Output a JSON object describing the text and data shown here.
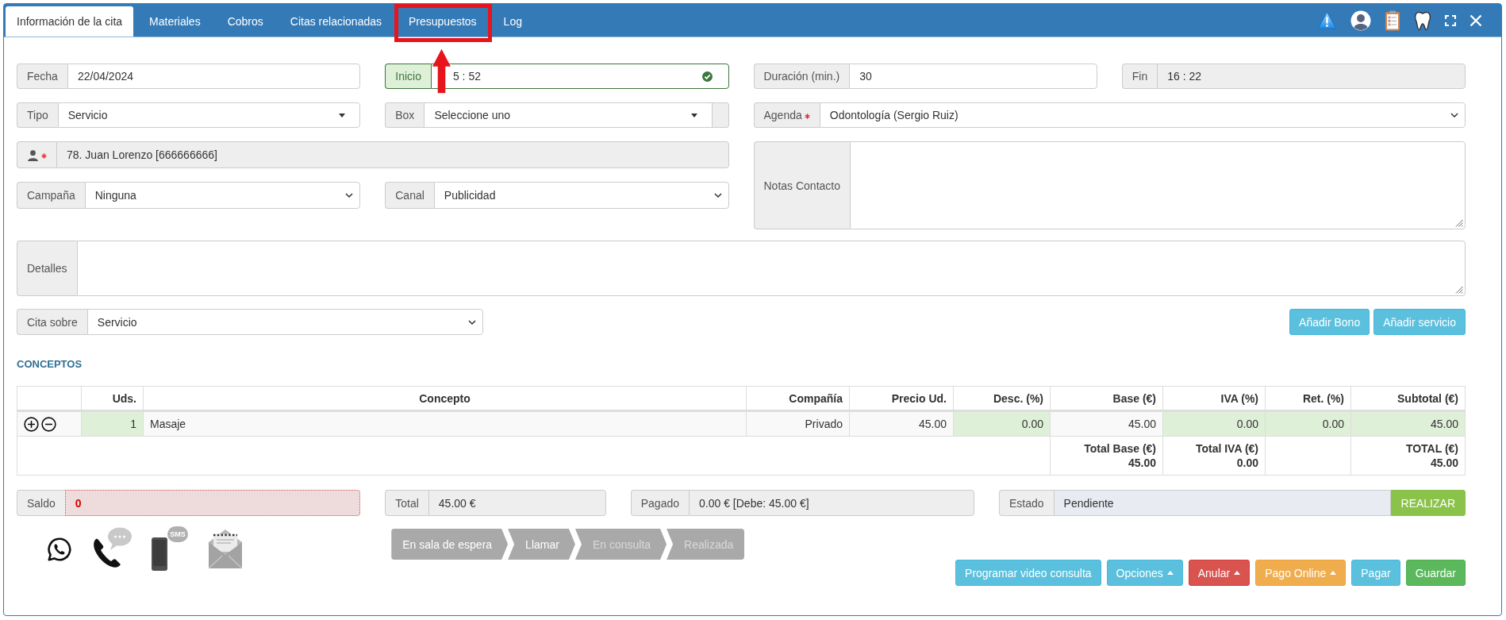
{
  "tabs": [
    {
      "label": "Información de la cita",
      "selected": true,
      "highlighted": false
    },
    {
      "label": "Materiales",
      "selected": false,
      "highlighted": false
    },
    {
      "label": "Cobros",
      "selected": false,
      "highlighted": false
    },
    {
      "label": "Citas relacionadas",
      "selected": false,
      "highlighted": false
    },
    {
      "label": "Presupuestos",
      "selected": false,
      "highlighted": true
    },
    {
      "label": "Log",
      "selected": false,
      "highlighted": false
    }
  ],
  "form": {
    "fecha": {
      "label": "Fecha",
      "value": "22/04/2024"
    },
    "inicio": {
      "label": "Inicio",
      "value": "5 : 52",
      "valid": true
    },
    "duracion": {
      "label": "Duración (min.)",
      "value": "30"
    },
    "fin": {
      "label": "Fin",
      "value": "16 : 22",
      "readonly": true
    },
    "tipo": {
      "kind": "picker",
      "label": "Tipo",
      "value": "Servicio"
    },
    "box": {
      "kind": "picker",
      "label": "Box",
      "value": "Seleccione uno",
      "addon": true
    },
    "agenda": {
      "kind": "select",
      "label": "Agenda",
      "value": "Odontología (Sergio Ruiz)",
      "required": true
    },
    "paciente": {
      "value": "78. Juan Lorenzo [666666666]",
      "readonly": true,
      "required": true
    },
    "notas_contacto": {
      "kind": "textarea",
      "label": "Notas Contacto"
    },
    "campana": {
      "kind": "select",
      "label": "Campaña",
      "value": "Ninguna"
    },
    "canal": {
      "kind": "select",
      "label": "Canal",
      "value": "Publicidad"
    },
    "detalles": {
      "kind": "textarea",
      "label": "Detalles"
    },
    "cita_sobre": {
      "kind": "select",
      "label": "Cita sobre",
      "value": "Servicio"
    }
  },
  "concept_buttons": [
    {
      "label": "Añadir Bono",
      "kind": "info"
    },
    {
      "label": "Añadir servicio",
      "kind": "info"
    }
  ],
  "conceptos": {
    "title": "CONCEPTOS",
    "columns": [
      "Uds.",
      "Concepto",
      "Compañía",
      "Precio Ud.",
      "Desc. (%)",
      "Base (€)",
      "IVA (%)",
      "Ret. (%)",
      "Subtotal (€)"
    ],
    "rows": [
      {
        "cells": [
          {
            "text": "1",
            "editable": true
          },
          {
            "text": "Masaje",
            "editable": false
          },
          {
            "text": "Privado",
            "editable": false
          },
          {
            "text": "45.00",
            "editable": false
          },
          {
            "text": "0.00",
            "editable": true
          },
          {
            "text": "45.00",
            "editable": false
          },
          {
            "text": "0.00",
            "editable": true
          },
          {
            "text": "0.00",
            "editable": true
          },
          {
            "text": "45.00",
            "editable": true
          }
        ]
      }
    ],
    "totals": {
      "base": {
        "label": "Total Base (€)",
        "value": "45.00"
      },
      "iva": {
        "label": "Total IVA (€)",
        "value": "0.00"
      },
      "total": {
        "label": "TOTAL (€)",
        "value": "45.00"
      }
    }
  },
  "summary": {
    "saldo": {
      "label": "Saldo",
      "value": "0",
      "error": true
    },
    "total": {
      "label": "Total",
      "value": "45.00 €",
      "readonly": true
    },
    "pagado": {
      "label": "Pagado",
      "value": "0.00 € [Debe: 45.00 €]",
      "readonly": true
    },
    "estado": {
      "label": "Estado",
      "value": "Pendiente",
      "action": "REALIZAR"
    }
  },
  "contact_actions": {
    "sms_label": "SMS"
  },
  "steps": [
    {
      "label": "En sala de espera",
      "reached": true
    },
    {
      "label": "Llamar",
      "reached": true
    },
    {
      "label": "En consulta",
      "reached": false
    },
    {
      "label": "Realizada",
      "reached": false
    }
  ],
  "buttons": [
    {
      "label": "Programar video consulta",
      "kind": "info",
      "menu": false
    },
    {
      "label": "Opciones",
      "kind": "info",
      "menu": true
    },
    {
      "label": "Anular",
      "kind": "danger",
      "menu": true
    },
    {
      "label": "Pago Online",
      "kind": "warning",
      "menu": true
    },
    {
      "label": "Pagar",
      "kind": "info",
      "menu": false
    },
    {
      "label": "Guardar",
      "kind": "success",
      "menu": false
    }
  ]
}
